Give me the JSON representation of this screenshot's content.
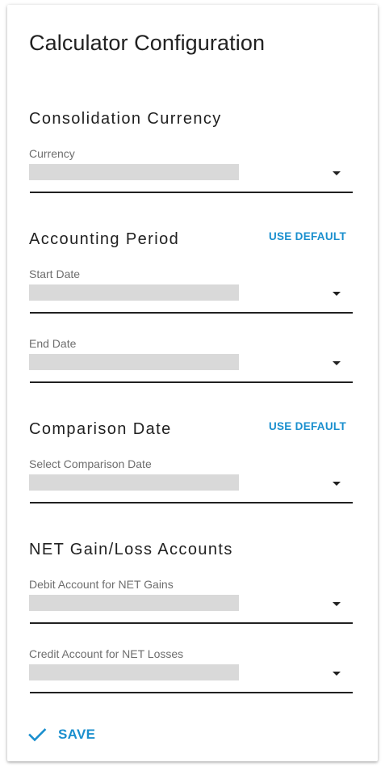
{
  "title": "Calculator Configuration",
  "colors": {
    "accent": "#1a8fce",
    "text": "#212121",
    "label": "#6e6e6e",
    "placeholder_fill": "#d9d9d9"
  },
  "sections": {
    "consolidation": {
      "title": "Consolidation Currency",
      "fields": {
        "currency": {
          "label": "Currency",
          "value": ""
        }
      }
    },
    "accounting_period": {
      "title": "Accounting Period",
      "use_default_label": "USE DEFAULT",
      "fields": {
        "start_date": {
          "label": "Start Date",
          "value": ""
        },
        "end_date": {
          "label": "End Date",
          "value": ""
        }
      }
    },
    "comparison_date": {
      "title": "Comparison Date",
      "use_default_label": "USE DEFAULT",
      "fields": {
        "select_comparison_date": {
          "label": "Select Comparison Date",
          "value": ""
        }
      }
    },
    "net_accounts": {
      "title": "NET Gain/Loss Accounts",
      "fields": {
        "debit_account": {
          "label": "Debit Account for NET Gains",
          "value": ""
        },
        "credit_account": {
          "label": "Credit Account for NET Losses",
          "value": ""
        }
      }
    }
  },
  "footer": {
    "save_label": "SAVE",
    "save_icon": "check-icon"
  }
}
